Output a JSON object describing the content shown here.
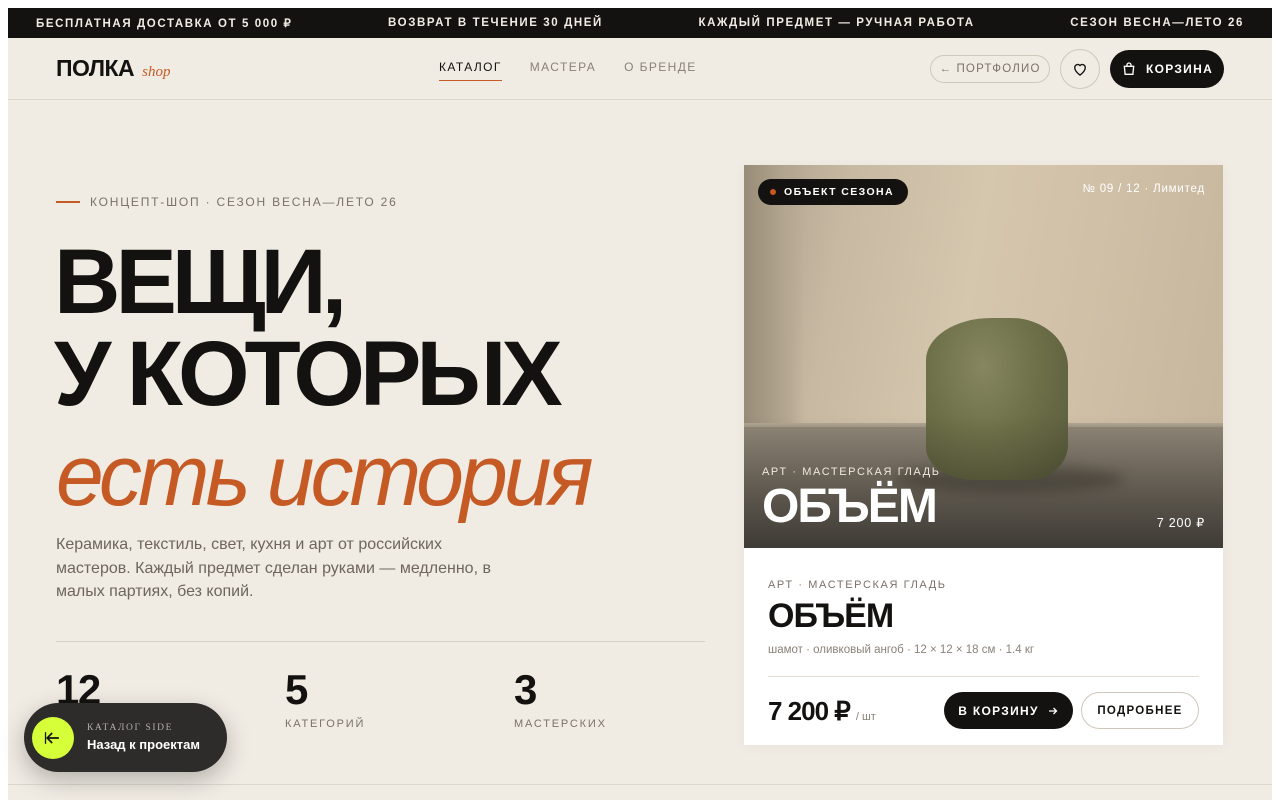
{
  "ticker": {
    "items": [
      "БЕСПЛАТНАЯ ДОСТАВКА ОТ 5 000 ₽",
      "ВОЗВРАТ В ТЕЧЕНИЕ 30 ДНЕЙ",
      "КАЖДЫЙ ПРЕДМЕТ — РУЧНАЯ РАБОТА",
      "СЕЗОН ВЕСНА—ЛЕТО 26"
    ]
  },
  "header": {
    "logo_main": "ПОЛКА",
    "logo_sub": "shop",
    "nav": [
      "КАТАЛОГ",
      "МАСТЕРА",
      "О БРЕНДЕ"
    ],
    "nav_active": "КАТАЛОГ",
    "portfolio_label": "← ПОРТФОЛИО",
    "cart_label": "КОРЗИНА",
    "icons": {
      "favorite": "heart-icon",
      "cart": "bag-icon"
    }
  },
  "hero": {
    "eyebrow": "КОНЦЕПТ-ШОП · СЕЗОН ВЕСНА—ЛЕТО 26",
    "title_line1": "ВЕЩИ,",
    "title_line2": "У КОТОРЫХ",
    "title_accent": "есть история",
    "lead": "Керамика, текстиль, свет, кухня и арт от российских мастеров. Каждый предмет сделан руками — медленно, в малых партиях, без копий.",
    "stats": [
      {
        "value": "12",
        "label": ""
      },
      {
        "value": "5",
        "label": "КАТЕГОРИЙ"
      },
      {
        "value": "3",
        "label": "МАСТЕРСКИХ"
      }
    ]
  },
  "product": {
    "badge": "ОБЪЕКТ СЕЗОНА",
    "edition": "№ 09 / 12 · Лимитед",
    "meta": "АРТ · МАСТЕРСКАЯ ГЛАДЬ",
    "title": "ОБЪЁМ",
    "photo_price": "7 200 ₽",
    "spec": "шамот · оливковый ангоб · 12 × 12 × 18 см · 1.4 кг",
    "price": "7 200 ₽",
    "unit": "/ шт",
    "add_label": "В КОРЗИНУ",
    "more_label": "ПОДРОБНЕЕ"
  },
  "back": {
    "small": "КАТАЛОГ SIDE",
    "main": "Назад к проектам",
    "icon": "arrow-left-icon"
  },
  "colors": {
    "accent": "#c55a24",
    "background": "#f0ebe3",
    "dark": "#141210",
    "lime": "#d6ff3a"
  }
}
